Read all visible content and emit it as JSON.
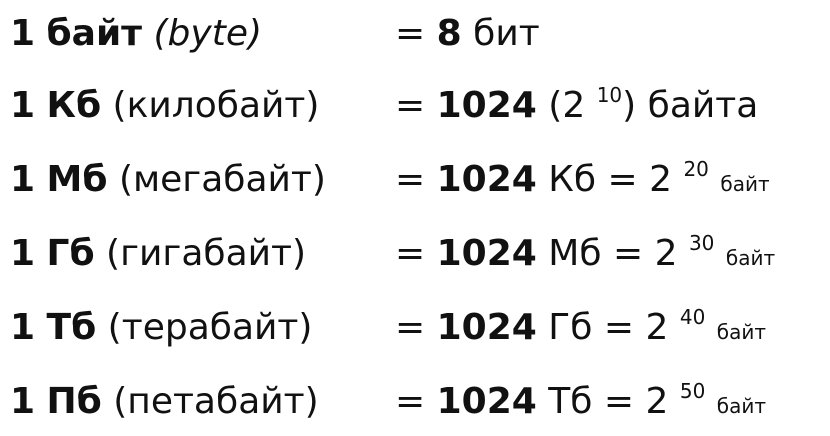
{
  "rows": [
    {
      "num": "1",
      "unit": "байт",
      "name": "(byte)",
      "eq": "=",
      "value": "8",
      "rest": "бит"
    },
    {
      "num": "1",
      "unit": "Кб",
      "name": "(килобайт)",
      "eq": "=",
      "value": "1024",
      "pre": "(2",
      "exp": "10",
      "post": ") байта"
    },
    {
      "num": "1",
      "unit": "Мб",
      "name": "(мегабайт)",
      "eq": "=",
      "value": "1024",
      "pre": "Кб = 2",
      "exp": "20",
      "post": "байт"
    },
    {
      "num": "1",
      "unit": "Гб",
      "name": "(гигабайт)",
      "eq": "=",
      "value": "1024",
      "pre": "Мб = 2",
      "exp": "30",
      "post": "байт"
    },
    {
      "num": "1",
      "unit": "Тб",
      "name": "(терабайт)",
      "eq": "=",
      "value": "1024",
      "pre": "Гб = 2",
      "exp": "40",
      "post": "байт"
    },
    {
      "num": "1",
      "unit": "Пб",
      "name": "(петабайт)",
      "eq": "=",
      "value": "1024",
      "pre": "Тб = 2",
      "exp": "50",
      "post": "байт"
    }
  ]
}
